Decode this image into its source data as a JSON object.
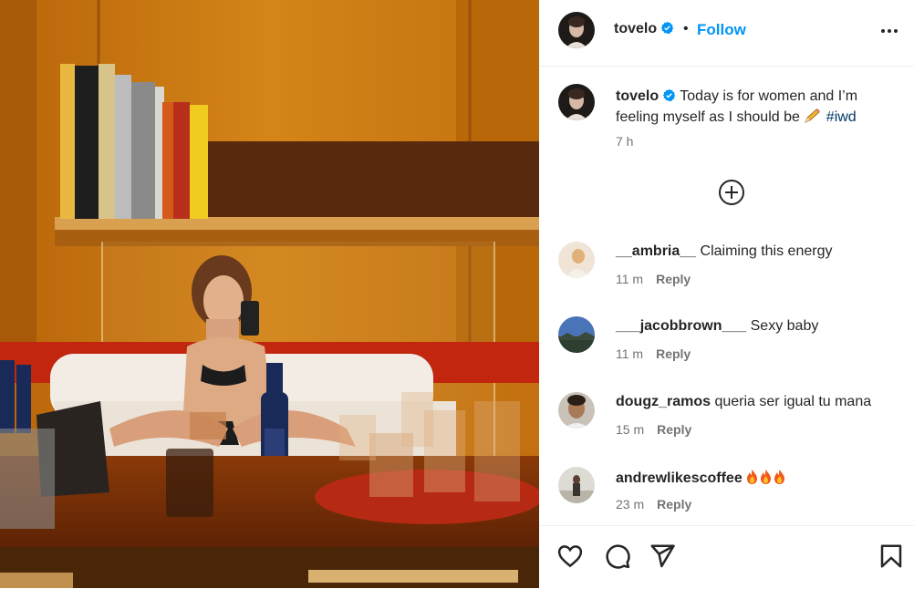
{
  "author": {
    "username": "tovelo",
    "follow_label": "Follow",
    "separator": "•"
  },
  "caption": {
    "username": "tovelo",
    "text": " Today is for women and I’m feeling myself as I should be ",
    "hashtag": "#iwd",
    "time": "7 h"
  },
  "comments": [
    {
      "username": "__ambria__",
      "text": "Claiming this energy",
      "time": "11 m",
      "reply": "Reply"
    },
    {
      "username": "___jacobbrown___",
      "text": "Sexy baby",
      "time": "11 m",
      "reply": "Reply"
    },
    {
      "username": "dougz_ramos",
      "text": "queria ser igual tu mana",
      "time": "15 m",
      "reply": "Reply"
    },
    {
      "username": "andrewlikescoffee",
      "text": "",
      "time": "23 m",
      "reply": "Reply"
    }
  ],
  "colors": {
    "accent": "#0095f6",
    "verified": "#0095f6",
    "muted": "#737373",
    "hashtag": "#00376b"
  },
  "icons": [
    "more-options-icon",
    "load-more-comments-icon",
    "like-heart-icon",
    "comment-icon",
    "share-icon",
    "save-bookmark-icon",
    "verified-badge-icon",
    "pencil-emoji-icon",
    "fire-emoji-icon"
  ]
}
